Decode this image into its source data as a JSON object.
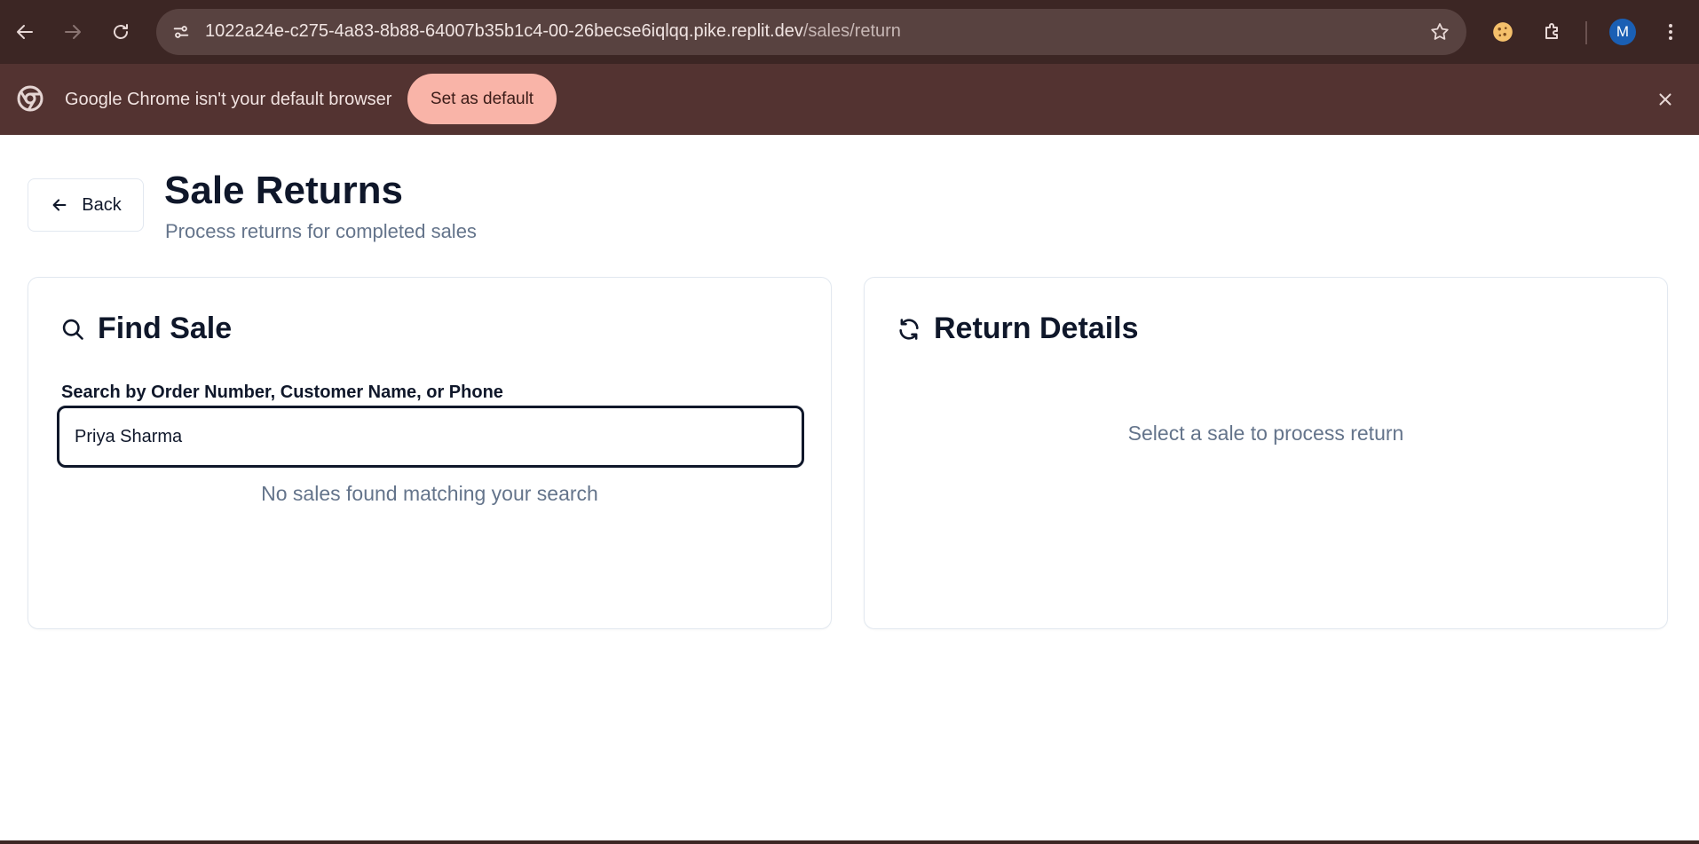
{
  "browser": {
    "url_host": "1022a24e-c275-4a83-8b88-64007b35b1c4-00-26becse6iqlqq.pike.replit.dev",
    "url_path": "/sales/return",
    "avatar_initial": "M",
    "icons": [
      "back-arrow-icon",
      "forward-arrow-icon",
      "reload-icon",
      "site-info-icon",
      "star-icon",
      "cookie-icon",
      "extensions-icon",
      "kebab-menu-icon"
    ],
    "colors": {
      "toolbar": "#3c2624",
      "omnibox": "#584240",
      "infobar": "#533331",
      "accent_button": "#f9b4a8"
    }
  },
  "infobar": {
    "message": "Google Chrome isn't your default browser",
    "button_label": "Set as default"
  },
  "header": {
    "back_label": "Back",
    "title": "Sale Returns",
    "subtitle": "Process returns for completed sales"
  },
  "find_sale": {
    "title": "Find Sale",
    "search_label": "Search by Order Number, Customer Name, or Phone",
    "search_value": "Priya Sharma",
    "empty_message": "No sales found matching your search"
  },
  "return_details": {
    "title": "Return Details",
    "empty_message": "Select a sale to process return"
  }
}
